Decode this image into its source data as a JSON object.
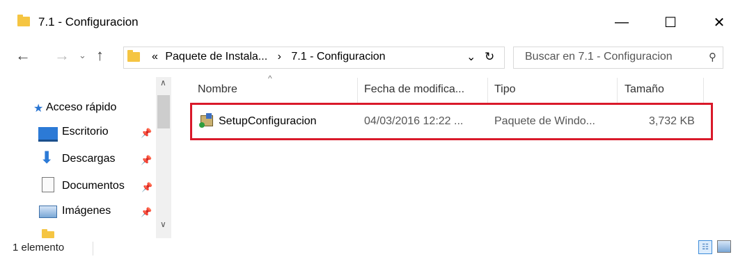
{
  "window": {
    "title": "7.1 - Configuracion",
    "controls": {
      "minimize": "—",
      "maximize": "☐",
      "close": "✕"
    }
  },
  "address_bar": {
    "overflow": "«",
    "crumbs": [
      "Paquete de Instala...",
      "7.1 - Configuracion"
    ],
    "separator": "›",
    "dropdown": "⌄",
    "refresh": "↻"
  },
  "search": {
    "placeholder": "Buscar en 7.1 - Configuracion"
  },
  "nav_pane": {
    "quick_access": "Acceso rápido",
    "items": [
      {
        "label": "Escritorio",
        "icon": "desktop-icon"
      },
      {
        "label": "Descargas",
        "icon": "download-icon"
      },
      {
        "label": "Documentos",
        "icon": "documents-icon"
      },
      {
        "label": "Imágenes",
        "icon": "pictures-icon"
      }
    ]
  },
  "columns": {
    "name": "Nombre",
    "date": "Fecha de modifica...",
    "type": "Tipo",
    "size": "Tamaño"
  },
  "files": [
    {
      "name": "SetupConfiguracion",
      "date": "04/03/2016 12:22 ...",
      "type": "Paquete de Windo...",
      "size": "3,732 KB"
    }
  ],
  "status": {
    "count": "1 elemento"
  },
  "colors": {
    "highlight": "#d9192a",
    "folder": "#f5c542"
  }
}
